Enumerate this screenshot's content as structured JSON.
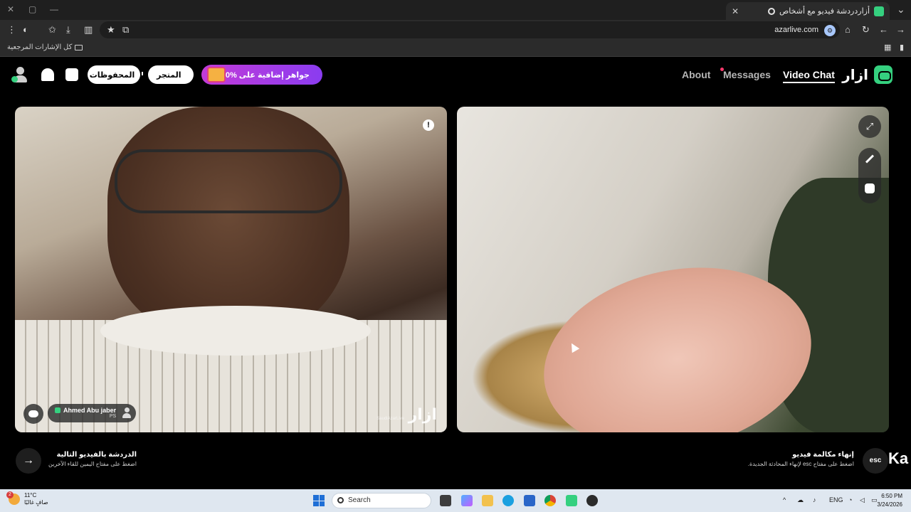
{
  "browser": {
    "tab_title": "أزاردردشة فيديو مع أشخاص",
    "url": "azarlive.com",
    "bookmarks_label": "كل الإشارات المرجعية"
  },
  "header": {
    "logo_text": "ازار",
    "nav": {
      "video_chat": "Video Chat",
      "messages": "Messages",
      "about": "About"
    },
    "promo_label": "10% جواهر إضافية على",
    "store_label": "المتجر",
    "saved_label": "المحفوظات"
  },
  "local_video": {
    "user_name": "Ahmed Abu jaber",
    "user_sub": "PS",
    "watermark": "ازار",
    "watermark_sub": "SaudiAzarLive"
  },
  "controls": {
    "next_title": "الدردشة بالفيديو التالية",
    "next_subtitle": "اضغط على مفتاح اليمين للقاء الآخرين",
    "end_title": "إنهاء مكالمة فيديو",
    "end_subtitle": "اضغط على مفتاح esc لإنهاء المحادثة الجديدة.",
    "esc_label": "esc",
    "ka_label": "Ka"
  },
  "taskbar": {
    "weather_temp": "11°C",
    "weather_desc": "صافٍ غالبًا",
    "weather_badge": "2",
    "search_placeholder": "Search",
    "language": "ENG",
    "time": "6:50 PM",
    "date": "3/24/2026"
  },
  "colors": {
    "brand_green": "#35d07f",
    "promo_start": "#c23bd8",
    "promo_end": "#8a3cf0",
    "messages_dot": "#ff3a6e"
  }
}
